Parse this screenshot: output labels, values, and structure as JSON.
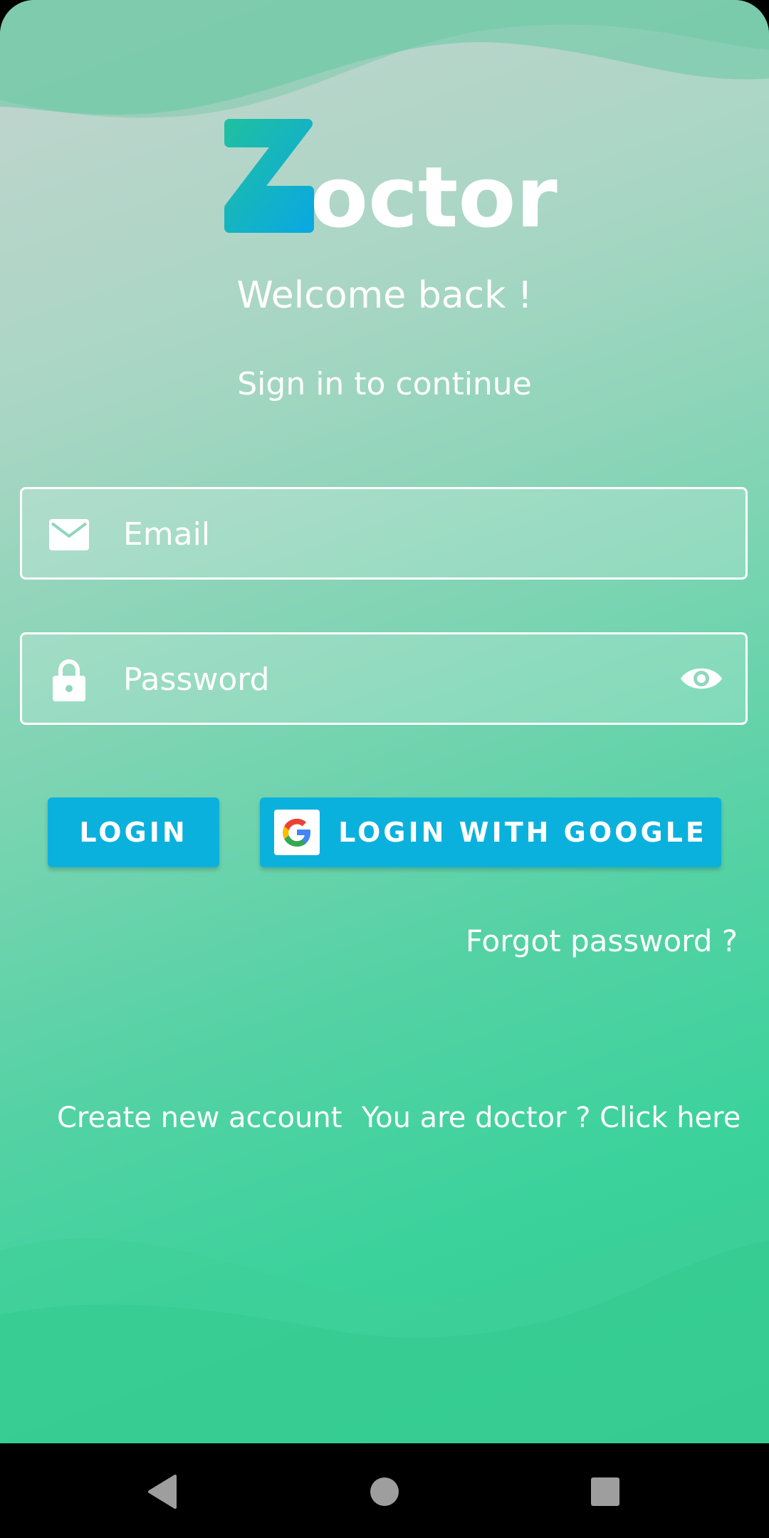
{
  "app": {
    "logo_letter": "Z",
    "logo_rest": "octor"
  },
  "header": {
    "welcome": "Welcome back !",
    "subtitle": "Sign in to continue"
  },
  "form": {
    "email_placeholder": "Email",
    "password_placeholder": "Password"
  },
  "buttons": {
    "login": "LOGIN",
    "google": "LOGIN WITH GOOGLE"
  },
  "links": {
    "forgot": "Forgot password ?",
    "create": "Create new account",
    "doctor": "You are doctor ? Click here"
  },
  "icons": {
    "email": "envelope-icon",
    "password": "lock-icon",
    "visibility": "eye-icon",
    "google": "google-g-icon",
    "nav_back": "triangle-back-icon",
    "nav_home": "circle-home-icon",
    "nav_recent": "square-recent-icon"
  },
  "colors": {
    "accent": "#0bb1dd",
    "background_top": "#c4d4cf",
    "background_bottom": "#31cc90",
    "text": "#ffffff"
  }
}
